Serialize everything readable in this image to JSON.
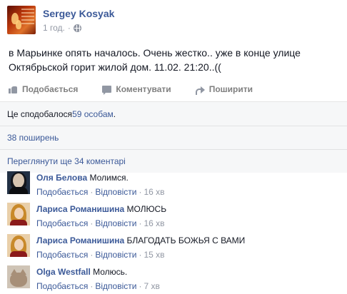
{
  "post": {
    "author": "Sergey Kosyak",
    "time": "1 год.",
    "separator": "·",
    "text": "в Марьинке опять началось. Очень жестко.. уже в конце улице Октябрьской горит жилой дом. 11.02. 21:20..(("
  },
  "actions": {
    "like_label": "Подобається",
    "comment_label": "Коментувати",
    "share_label": "Поширити"
  },
  "stats": {
    "likes_prefix": "Це сподобалося ",
    "likes_link": "59 особам",
    "likes_suffix": ".",
    "shares": "38 поширень",
    "more_comments": "Переглянути ще 34 коментарі"
  },
  "comments": [
    {
      "name": "Оля Белова",
      "text": "Молимся.",
      "like": "Подобається",
      "reply": "Відповісти",
      "time": "16 хв",
      "avatar": "avatar-dark-hair"
    },
    {
      "name": "Лариса Романишина",
      "text": "МОЛЮСЬ",
      "like": "Подобається",
      "reply": "Відповісти",
      "time": "16 хв",
      "avatar": "avatar-blonde"
    },
    {
      "name": "Лариса Романишина",
      "text": "БЛАГОДАТЬ БОЖЬЯ С ВАМИ",
      "like": "Подобається",
      "reply": "Відповісти",
      "time": "15 хв",
      "avatar": "avatar-blonde"
    },
    {
      "name": "Olga Westfall",
      "text": "Молюсь.",
      "like": "Подобається",
      "reply": "Відповісти",
      "time": "7 хв",
      "avatar": "avatar-cat"
    }
  ],
  "colors": {
    "link": "#3b5998",
    "meta": "#9197a3",
    "text": "#141823",
    "stats_bg": "#f6f7f8"
  }
}
